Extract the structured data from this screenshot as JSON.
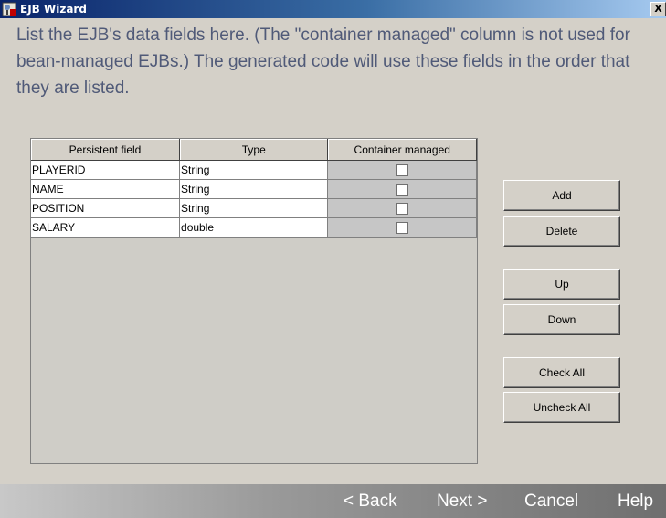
{
  "window": {
    "title": "EJB Wizard",
    "close_glyph": "X",
    "icon": "wizard-app-icon"
  },
  "instructions": "List the EJB's data fields here.  (The \"container managed\" column is not used for bean-managed EJBs.)  The generated code will use these fields in the order that they are listed.",
  "table": {
    "headers": [
      "Persistent field",
      "Type",
      "Container managed"
    ],
    "rows": [
      {
        "field": "PLAYERID",
        "type": "String",
        "container_managed": false
      },
      {
        "field": "NAME",
        "type": "String",
        "container_managed": false
      },
      {
        "field": "POSITION",
        "type": "String",
        "container_managed": false
      },
      {
        "field": "SALARY",
        "type": "double",
        "container_managed": false
      }
    ]
  },
  "buttons": {
    "add": "Add",
    "delete": "Delete",
    "up": "Up",
    "down": "Down",
    "check_all": "Check All",
    "uncheck_all": "Uncheck All"
  },
  "navigation": {
    "back": "< Back",
    "next": "Next >",
    "cancel": "Cancel",
    "help": "Help"
  }
}
